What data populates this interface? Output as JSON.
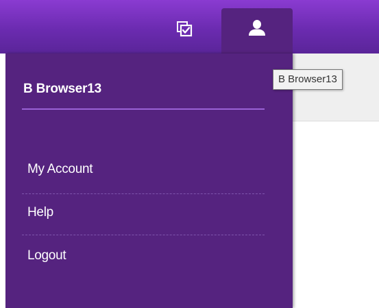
{
  "header": {
    "tasks_icon": "checkbox-tasks-icon",
    "user_icon": "user-silhouette-icon",
    "colors": {
      "bar_top": "#8a3bd1",
      "bar_bottom": "#5a2599",
      "menu_bg": "#55237f"
    }
  },
  "user_menu": {
    "username": "B Browser13",
    "items": [
      {
        "label": "My Account"
      },
      {
        "label": "Help"
      },
      {
        "label": "Logout"
      }
    ]
  },
  "tooltip": {
    "text": "B Browser13"
  }
}
